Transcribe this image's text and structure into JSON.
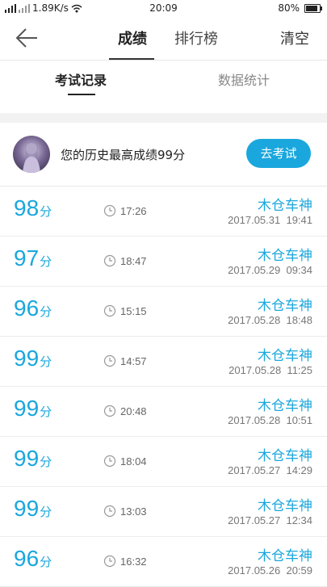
{
  "status_bar": {
    "left_text": "1.89K/s",
    "time": "20:09",
    "battery": "80%"
  },
  "header": {
    "back_icon": "back-arrow-icon",
    "tabs": [
      {
        "label": "成绩",
        "active": true
      },
      {
        "label": "排行榜",
        "active": false
      }
    ],
    "clear_label": "清空"
  },
  "subtabs": [
    {
      "label": "考试记录",
      "active": true
    },
    {
      "label": "数据统计",
      "active": false
    }
  ],
  "best": {
    "text": "您的历史最高成绩99分",
    "button_label": "去考试"
  },
  "records": [
    {
      "score": "98",
      "unit": "分",
      "duration": "17:26",
      "name": "木仓车神",
      "datetime": "2017.05.31  19:41"
    },
    {
      "score": "97",
      "unit": "分",
      "duration": "18:47",
      "name": "木仓车神",
      "datetime": "2017.05.29  09:34"
    },
    {
      "score": "96",
      "unit": "分",
      "duration": "15:15",
      "name": "木仓车神",
      "datetime": "2017.05.28  18:48"
    },
    {
      "score": "99",
      "unit": "分",
      "duration": "14:57",
      "name": "木仓车神",
      "datetime": "2017.05.28  11:25"
    },
    {
      "score": "99",
      "unit": "分",
      "duration": "20:48",
      "name": "木仓车神",
      "datetime": "2017.05.28  10:51"
    },
    {
      "score": "99",
      "unit": "分",
      "duration": "18:04",
      "name": "木仓车神",
      "datetime": "2017.05.27  14:29"
    },
    {
      "score": "99",
      "unit": "分",
      "duration": "13:03",
      "name": "木仓车神",
      "datetime": "2017.05.27  12:34"
    },
    {
      "score": "96",
      "unit": "分",
      "duration": "16:32",
      "name": "木仓车神",
      "datetime": "2017.05.26  20:59"
    }
  ],
  "colors": {
    "accent": "#1aa7dd"
  }
}
